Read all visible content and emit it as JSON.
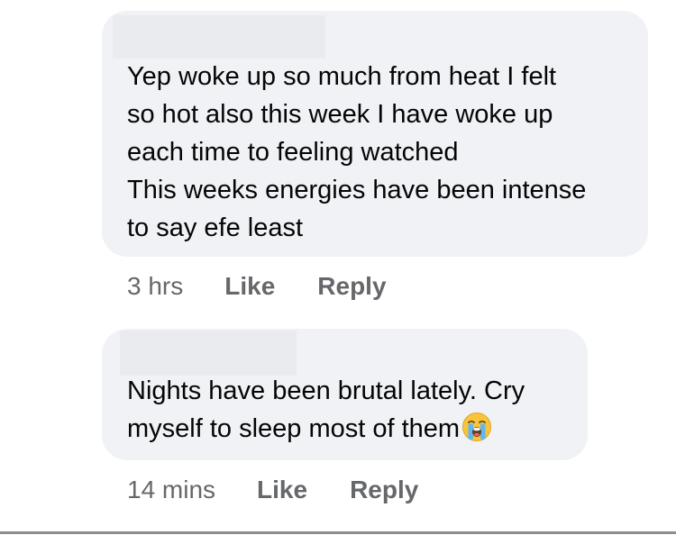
{
  "comments": [
    {
      "text": "Yep woke up so much from heat I felt\nso hot also this week I have woke up\neach time to feeling watched\nThis weeks energies have been intense\nto say efe least",
      "time": "3 hrs",
      "like_label": "Like",
      "reply_label": "Reply"
    },
    {
      "text": "Nights have been brutal lately. Cry\nmyself to sleep most of them",
      "emoji": "loudly-crying-face-icon",
      "time": "14 mins",
      "like_label": "Like",
      "reply_label": "Reply"
    }
  ],
  "colors": {
    "bubble_background": "#f0f2f5",
    "text": "#050505",
    "meta_text": "#65676b",
    "divider": "#8a8d91"
  }
}
